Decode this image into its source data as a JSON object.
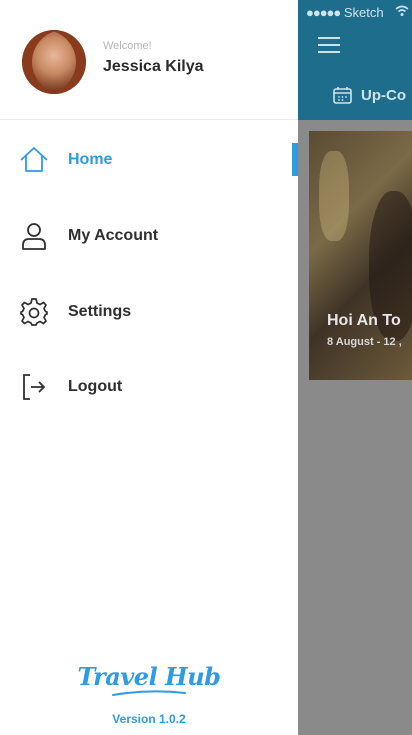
{
  "background_app": {
    "status": {
      "signal": "●●●●●",
      "carrier": "Sketch"
    },
    "tab_label": "Up-Co",
    "card": {
      "title": "Hoi An To",
      "date": "8 August - 12 ,"
    }
  },
  "profile": {
    "welcome": "Welcome!",
    "name": "Jessica Kilya"
  },
  "nav": {
    "items": [
      {
        "label": "Home",
        "icon": "home-icon",
        "active": true
      },
      {
        "label": "My Account",
        "icon": "user-icon",
        "active": false
      },
      {
        "label": "Settings",
        "icon": "gear-icon",
        "active": false
      },
      {
        "label": "Logout",
        "icon": "logout-icon",
        "active": false
      }
    ]
  },
  "footer": {
    "logo": "Travel Hub",
    "version": "Version 1.0.2"
  },
  "colors": {
    "accent": "#2f9be3",
    "header": "#1f6d8c",
    "overlay": "#8a8a8a"
  }
}
